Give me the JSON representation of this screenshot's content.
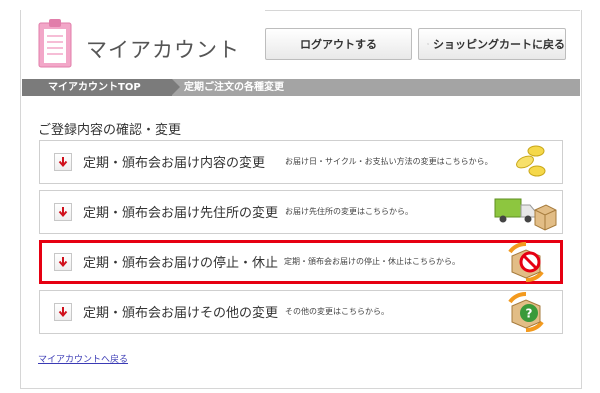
{
  "header": {
    "title": "マイアカウント",
    "logout_label": "ログアウトする",
    "cart_label": "ショッピングカートに戻る"
  },
  "breadcrumb": {
    "items": [
      {
        "label": "マイアカウントTOP"
      },
      {
        "label": "定期ご注文の各種変更"
      }
    ]
  },
  "section": {
    "title": "ご登録内容の確認・変更"
  },
  "menu": [
    {
      "title": "定期・頒布会お届け内容の変更",
      "desc": "お届け日・サイクル・お支払い方法の変更はこちらから。",
      "icon": "coins-icon"
    },
    {
      "title": "定期・頒布会お届け先住所の変更",
      "desc": "お届け先住所の変更はこちらから。",
      "icon": "delivery-truck-icon"
    },
    {
      "title": "定期・頒布会お届けの停止・休止",
      "desc": "定期・頒布会お届けの停止・休止はこちらから。",
      "icon": "stop-box-icon"
    },
    {
      "title": "定期・頒布会お届けその他の変更",
      "desc": "その他の変更はこちらから。",
      "icon": "question-box-icon"
    }
  ],
  "footer": {
    "back_link": "マイアカウントへ戻る"
  },
  "colors": {
    "highlight": "#e60012",
    "breadcrumb_active": "#7b7b7b",
    "logo_pink": "#f2a7c8"
  }
}
